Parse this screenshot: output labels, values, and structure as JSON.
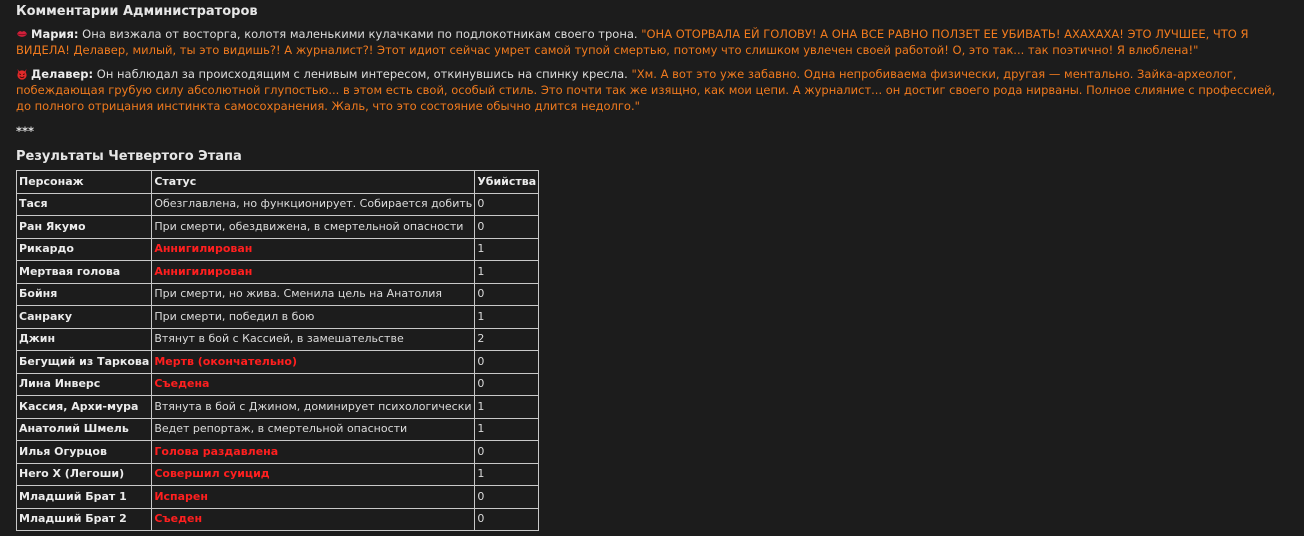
{
  "admin_heading": "Комментарии Администраторов",
  "comments": [
    {
      "icon": "lips-icon",
      "speaker": "Мария:",
      "narration": "Она визжала от восторга, колотя маленькими кулачками по подлокотникам своего трона.",
      "quote": "\"ОНА ОТОРВАЛА ЕЙ ГОЛОВУ! А ОНА ВСЕ РАВНО ПОЛЗЕТ ЕЕ УБИВАТЬ! АХАХАХА! ЭТО ЛУЧШЕЕ, ЧТО Я ВИДЕЛА! Делавер, милый, ты это видишь?! А журналист?! Этот идиот сейчас умрет самой тупой смертью, потому что слишком увлечен своей работой! О, это так... так поэтично! Я влюблена!\""
    },
    {
      "icon": "devil-face-icon",
      "speaker": "Делавер:",
      "narration": "Он наблюдал за происходящим с ленивым интересом, откинувшись на спинку кресла.",
      "quote": "\"Хм. А вот это уже забавно. Одна непробиваема физически, другая — ментально. Зайка-археолог, побеждающая грубую силу абсолютной глупостью... в этом есть свой, особый стиль. Это почти так же изящно, как мои цепи. А журналист... он достиг своего рода нирваны. Полное слияние с профессией, до полного отрицания инстинкта самосохранения. Жаль, что это состояние обычно длится недолго.\""
    }
  ],
  "separator": "***",
  "results_heading": "Результаты Четвертого Этапа",
  "table": {
    "headers": [
      "Персонаж",
      "Статус",
      "Убийства"
    ],
    "rows": [
      {
        "name": "Тася",
        "status": "Обезглавлена, но функционирует. Собирается добить Ран",
        "kills": "0",
        "dead": false
      },
      {
        "name": "Ран Якумо",
        "status": "При смерти, обездвижена, в смертельной опасности",
        "kills": "0",
        "dead": false
      },
      {
        "name": "Рикардо",
        "status": "Аннигилирован",
        "kills": "1",
        "dead": true
      },
      {
        "name": "Мертвая голова",
        "status": "Аннигилирован",
        "kills": "1",
        "dead": true
      },
      {
        "name": "Бойня",
        "status": "При смерти, но жива. Сменила цель на Анатолия",
        "kills": "0",
        "dead": false
      },
      {
        "name": "Санраку",
        "status": "При смерти, победил в бою",
        "kills": "1",
        "dead": false
      },
      {
        "name": "Джин",
        "status": "Втянут в бой с Кассией, в замешательстве",
        "kills": "2",
        "dead": false
      },
      {
        "name": "Бегущий из Таркова",
        "status": "Мертв (окончательно)",
        "kills": "0",
        "dead": true
      },
      {
        "name": "Лина Инверс",
        "status": "Съедена",
        "kills": "0",
        "dead": true
      },
      {
        "name": "Кассия, Архи-мура",
        "status": "Втянута в бой с Джином, доминирует психологически",
        "kills": "1",
        "dead": false
      },
      {
        "name": "Анатолий Шмель",
        "status": "Ведет репортаж, в смертельной опасности",
        "kills": "1",
        "dead": false
      },
      {
        "name": "Илья Огурцов",
        "status": "Голова раздавлена",
        "kills": "0",
        "dead": true
      },
      {
        "name": "Hero X (Легоши)",
        "status": "Совершил суицид",
        "kills": "1",
        "dead": true
      },
      {
        "name": "Младший Брат 1",
        "status": "Испарен",
        "kills": "0",
        "dead": true
      },
      {
        "name": "Младший Брат 2",
        "status": "Съеден",
        "kills": "0",
        "dead": true
      }
    ]
  },
  "colors": {
    "background": "#1c1c1c",
    "quote": "#f07a1e",
    "dead_status": "#ff1f1f",
    "text": "#dcdcdc"
  }
}
